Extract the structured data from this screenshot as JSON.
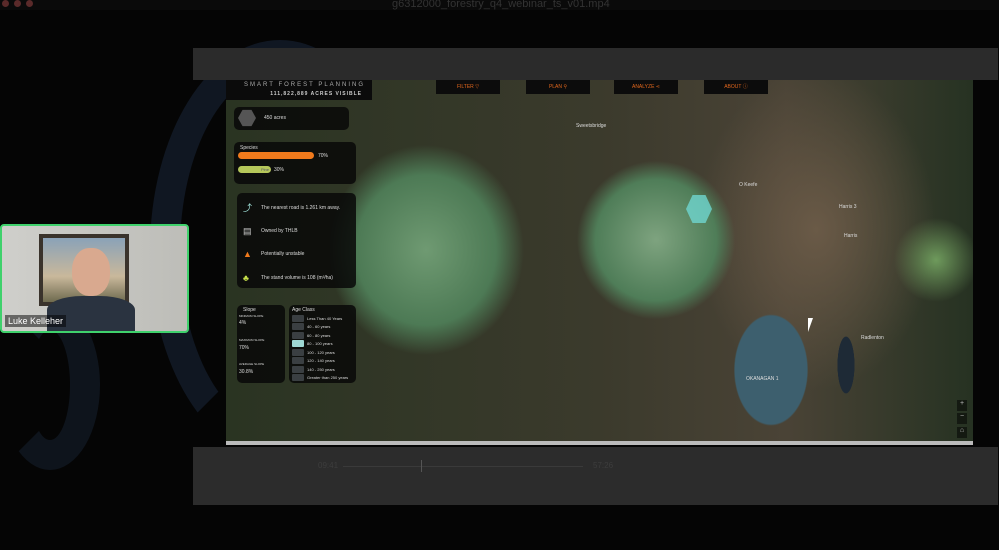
{
  "window": {
    "filename": "g6312000_forestry_q4_webinar_ts_v01.mp4"
  },
  "participant": {
    "name": "Luke Kelleher"
  },
  "player": {
    "current_time": "09:41",
    "total_time": "57:26"
  },
  "app": {
    "title": "SMART FOREST PLANNING",
    "acres_visible": "111,822,889 ACRES VISIBLE",
    "nav": [
      {
        "label": "FILTER",
        "icon": "funnel-icon"
      },
      {
        "label": "PLAN",
        "icon": "search-icon"
      },
      {
        "label": "ANALYZE",
        "icon": "share-icon"
      },
      {
        "label": "ABOUT",
        "icon": "info-icon"
      }
    ]
  },
  "stand": {
    "area": "450 acres"
  },
  "species": {
    "title": "Species",
    "items": [
      {
        "label": "",
        "pct_label": "70%",
        "value": 70,
        "color": "#f07a1c"
      },
      {
        "label": "Pine",
        "pct_label": "30%",
        "value": 30,
        "color": "#b5c75a"
      }
    ]
  },
  "info": [
    {
      "icon": "road-icon",
      "text": "The nearest road is 1.261 km away."
    },
    {
      "icon": "document-icon",
      "text": "Owned by THLB"
    },
    {
      "icon": "mountain-warning-icon",
      "text": "Potentially unstable"
    },
    {
      "icon": "tree-icon",
      "text": "The stand volume is 108 (m³/ha)"
    }
  ],
  "slope": {
    "title": "Slope",
    "minimum_label": "MINIMUM SLOPE",
    "minimum": "4%",
    "maximum_label": "MAXIMUM SLOPE",
    "maximum": "70%",
    "average_label": "AVERAGE SLOPE",
    "average": "30.8%"
  },
  "age_class": {
    "title": "Age Class",
    "selected": 3,
    "items": [
      "Less Than 40 Years",
      "40 - 60 years",
      "60 - 80 years",
      "80 - 100 years",
      "100 - 120 years",
      "120 - 140 years",
      "140 - 250 years",
      "Greater than 250 years"
    ]
  },
  "map_labels": [
    "Sweetsbridge",
    "O Keefe",
    "Harris 3",
    "Harris",
    "OKANAGAN 1",
    "Radlenton"
  ],
  "map_controls": {
    "zoom_in": "+",
    "zoom_out": "−"
  }
}
